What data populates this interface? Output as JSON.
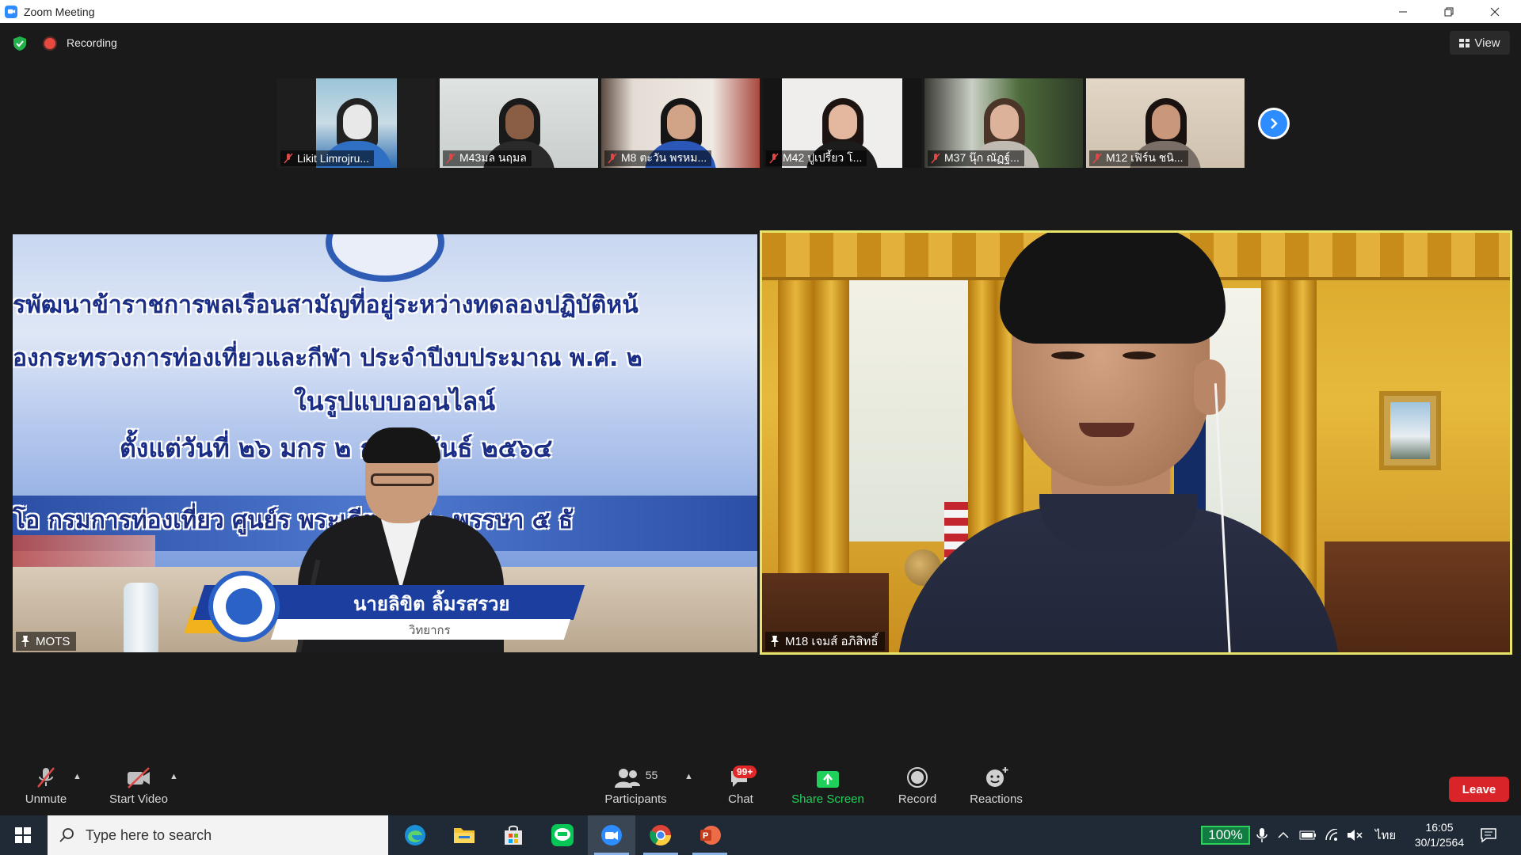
{
  "window": {
    "title": "Zoom Meeting"
  },
  "topbar": {
    "recording_label": "Recording",
    "view_label": "View"
  },
  "thumbnails": [
    {
      "name": "Likit Limrojru...",
      "scene": "poster"
    },
    {
      "name": "M43มล นฤมล",
      "scene": "white-tiles"
    },
    {
      "name": "M8 ตะวัน พรหม...",
      "scene": "curtain"
    },
    {
      "name": "M42 ปูเปรี้ยว โ...",
      "scene": "white-wall"
    },
    {
      "name": "M37 นุ๊ก ณัฏฐ์...",
      "scene": "plants"
    },
    {
      "name": "M12 เฟิร์น ชนิ...",
      "scene": "beige"
    }
  ],
  "main_tiles": {
    "left": {
      "name": "MOTS",
      "banner_lines": [
        "รพัฒนาข้าราชการพลเรือนสามัญที่อยู่ระหว่างทดลองปฏิบัติหน้",
        "องกระทรวงการท่องเที่ยวและกีฬา ประจำปีงบประมาณ พ.ศ. ๒",
        "ในรูปแบบออนไลน์",
        "ตั้งแต่วันที่ ๒๖ มกร          ๒ กุมภาพันธ์ ๒๕๖๔",
        "โอ กรมการท่องเที่ยว ศูนย์ร          พระเกียรติ ๘๐ พรรษา ๕ ธั"
      ],
      "speaker_name": "นายลิขิต ลิ้มรสรวย",
      "speaker_title": "วิทยากร"
    },
    "right": {
      "name": "M18 เจมส์ อภิสิทธิ์"
    }
  },
  "toolbar": {
    "unmute_label": "Unmute",
    "start_video_label": "Start Video",
    "participants_label": "Participants",
    "participants_count": "55",
    "chat_label": "Chat",
    "chat_badge": "99+",
    "share_screen_label": "Share Screen",
    "record_label": "Record",
    "reactions_label": "Reactions",
    "leave_label": "Leave"
  },
  "taskbar": {
    "search_placeholder": "Type here to search",
    "apps": [
      "edge-icon",
      "file-explorer-icon",
      "store-icon",
      "line-icon",
      "zoom-icon",
      "chrome-icon",
      "powerpoint-icon"
    ],
    "battery_percent": "100%",
    "language": "ไทย",
    "time": "16:05",
    "date": "30/1/2564"
  },
  "colors": {
    "zoom_blue": "#2d8cff",
    "share_green": "#1fd15a",
    "leave_red": "#d9252a",
    "active_speaker_border": "#e7e56a"
  }
}
